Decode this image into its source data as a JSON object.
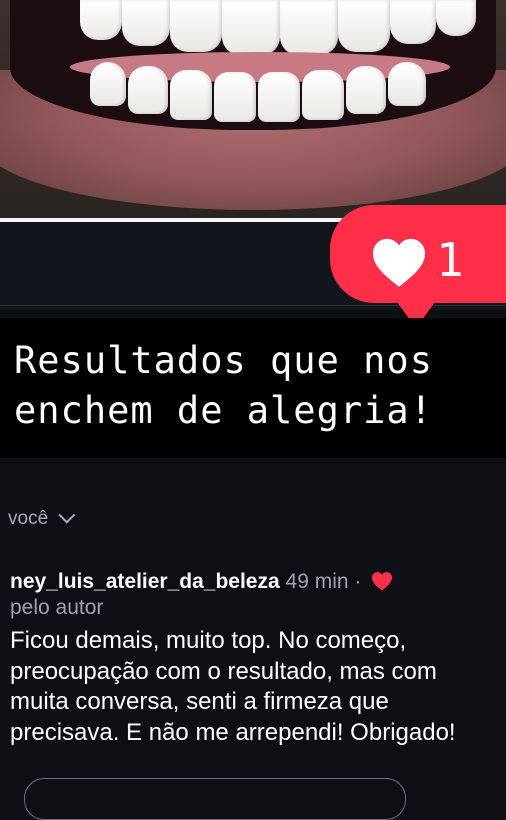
{
  "like_badge": {
    "count": "1",
    "color": "#ff2f4a"
  },
  "caption": {
    "text": "Resultados que nos\nenchem de alegria!"
  },
  "thread": {
    "viewer_label": "você"
  },
  "comment": {
    "username": "ney_luis_atelier_da_beleza",
    "time": "49 min ·",
    "author_note": "pelo autor",
    "text": "Ficou demais, muito top. No começo, preocupação com o resultado,  mas com muita conversa,  senti a firmeza que precisava. E não me arrependi! Obrigado!"
  },
  "icons": {
    "like": "heart-icon",
    "liked_by_author": "heart-icon",
    "expand": "chevron-down-icon"
  }
}
